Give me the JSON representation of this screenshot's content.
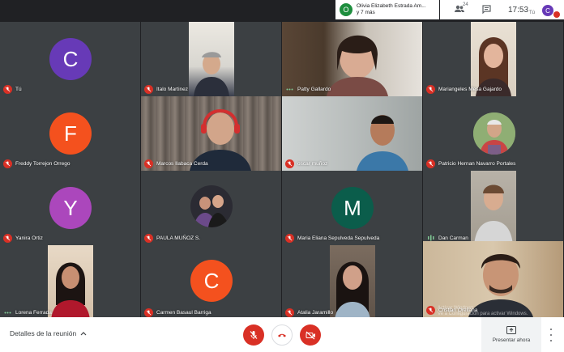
{
  "topbar": {
    "presenter_initial": "O",
    "presenter_name": "Olivia Elizabeth Estrada Am...",
    "presenter_more": "y 7 más",
    "participants_count": "24",
    "time": "17:53",
    "self_label": "Tú",
    "self_initial": "C"
  },
  "tiles": [
    {
      "name": "Tú",
      "initial": "C",
      "color": "#673ab7",
      "muted": true
    },
    {
      "name": "Italo Martinez",
      "muted": true
    },
    {
      "name": "Patty Gallardo",
      "muted": false
    },
    {
      "name": "Mariangeles Mesa Gajardo",
      "muted": true
    },
    {
      "name": "Freddy Torrejon Orrego",
      "initial": "F",
      "color": "#f4511e",
      "muted": true
    },
    {
      "name": "Marcos Ilabaca Cerda",
      "muted": true
    },
    {
      "name": "oscar muñoz",
      "muted": true
    },
    {
      "name": "Patricio Hernan Navarro Portales",
      "muted": true
    },
    {
      "name": "Yanira Ortiz",
      "initial": "Y",
      "color": "#ab47bc",
      "muted": true
    },
    {
      "name": "PAULA MUÑOZ S.",
      "muted": true
    },
    {
      "name": "Maria Eliana Sepulveda Sepulveda",
      "initial": "M",
      "color": "#0b5d4b",
      "muted": true
    },
    {
      "name": "Dan Carman",
      "muted": false
    },
    {
      "name": "Lorena Ferrada",
      "muted": false
    },
    {
      "name": "Carmen Basaul Barriga",
      "initial": "C",
      "color": "#f4511e",
      "muted": true
    },
    {
      "name": "Atalia Jaramillo",
      "muted": true
    },
    {
      "name": "Cristian Orellana",
      "muted": true
    }
  ],
  "watermark": {
    "line1": "Activar Windows",
    "line2": "Ve a Configuración para activar Windows."
  },
  "bottombar": {
    "meeting_details": "Detalles de la reunión",
    "present_label": "Presentar ahora"
  },
  "colors": {
    "mute_red": "#d93025",
    "speaking_green": "#1e8e3e",
    "tile_bg": "#3c4043",
    "page_bg": "#202124"
  }
}
